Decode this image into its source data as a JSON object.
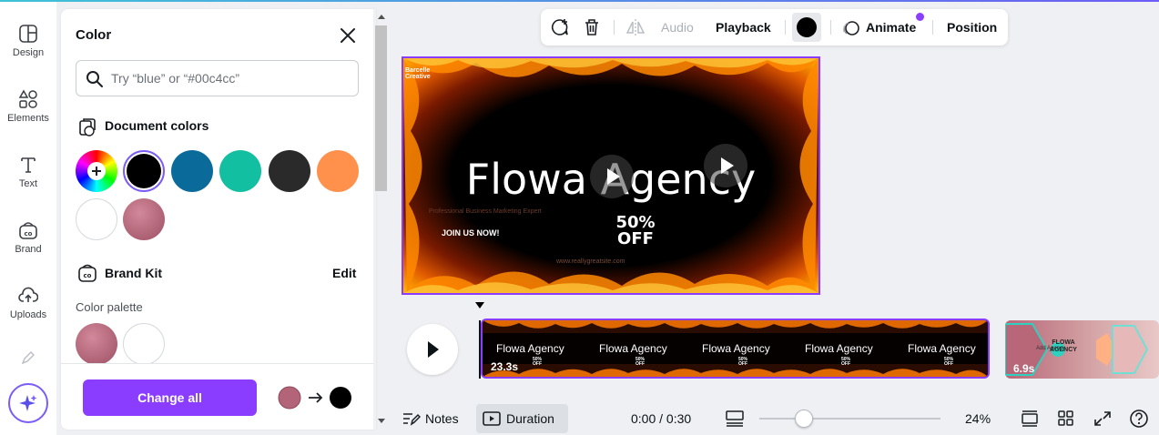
{
  "sidebar": {
    "items": [
      {
        "label": "Design",
        "icon": "design-icon"
      },
      {
        "label": "Elements",
        "icon": "elements-icon"
      },
      {
        "label": "Text",
        "icon": "text-icon"
      },
      {
        "label": "Brand",
        "icon": "brand-icon"
      },
      {
        "label": "Uploads",
        "icon": "uploads-icon"
      }
    ],
    "magic_icon": "sparkle-icon"
  },
  "color_panel": {
    "title": "Color",
    "search_placeholder": "Try “blue” or “#00c4cc”",
    "document_colors_title": "Document colors",
    "document_colors": [
      "#000000",
      "#0a6b9a",
      "#12bfa0",
      "#2a2a2a",
      "#ff914d",
      "#ffffff",
      "#b46478"
    ],
    "selected_color": "#000000",
    "brand_kit_title": "Brand Kit",
    "brand_kit_edit": "Edit",
    "palette_label": "Color palette",
    "palette_colors": [
      "#b46478",
      "#ffffff"
    ],
    "change_all_label": "Change all",
    "change_from": "#b46478",
    "change_to": "#000000"
  },
  "toolbar": {
    "audio_label": "Audio",
    "playback_label": "Playback",
    "color_value": "#000000",
    "animate_label": "Animate",
    "position_label": "Position"
  },
  "canvas": {
    "logo_line1": "Barcelle",
    "logo_line2": "Creative",
    "headline": "Flowa Agency",
    "subtitle": "Professional Business Marketing Expert",
    "cta": "JOIN US NOW!",
    "offer_line1": "50%",
    "offer_line2": "OFF",
    "website": "www.reallygreatsite.com"
  },
  "timeline": {
    "clips": [
      "Flowa Agency",
      "Flowa Agency",
      "Flowa Agency",
      "Flowa Agency",
      "Flowa Agency"
    ],
    "clip_offer": "50% OFF",
    "page1_duration": "23.3s",
    "page2_duration": "6.9s",
    "page2_title_line1": "FLOWA",
    "page2_title_line2": "AGENCY",
    "page2_overlay": "Add Agency"
  },
  "bottom_bar": {
    "notes_label": "Notes",
    "duration_label": "Duration",
    "time": "0:00 / 0:30",
    "zoom": "24%",
    "zoom_level": 0.24
  }
}
